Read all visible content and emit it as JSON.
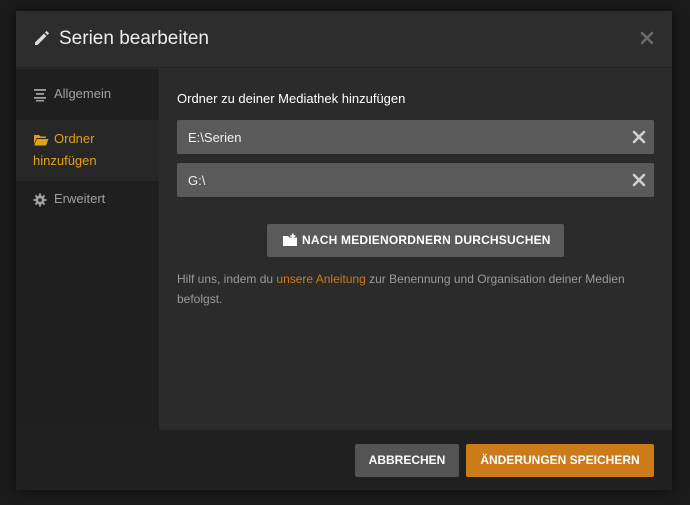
{
  "dialog": {
    "title": "Serien bearbeiten"
  },
  "sidebar": {
    "items": [
      {
        "label": "Allgemein",
        "icon": "list-lines-icon",
        "active": false
      },
      {
        "label_line1": "Ordner",
        "label_line2": "hinzufügen",
        "icon": "folder-open-icon",
        "active": true
      },
      {
        "label": "Erweitert",
        "icon": "gear-icon",
        "active": false
      }
    ]
  },
  "main": {
    "section_label": "Ordner zu deiner Mediathek hinzufügen",
    "folders": [
      "E:\\Serien",
      "G:\\"
    ],
    "browse_label": "NACH MEDIENORDNERN DURCHSUCHEN",
    "hint": {
      "before": "Hilf uns, indem du ",
      "link": "unsere Anleitung",
      "after": " zur Benennung und Organisation deiner Medien befolgst."
    }
  },
  "footer": {
    "cancel_label": "ABBRECHEN",
    "save_label": "ÄNDERUNGEN SPEICHERN"
  },
  "colors": {
    "accent": "#e5a00d",
    "button_primary": "#cc7b19",
    "link": "#cc7b19"
  }
}
